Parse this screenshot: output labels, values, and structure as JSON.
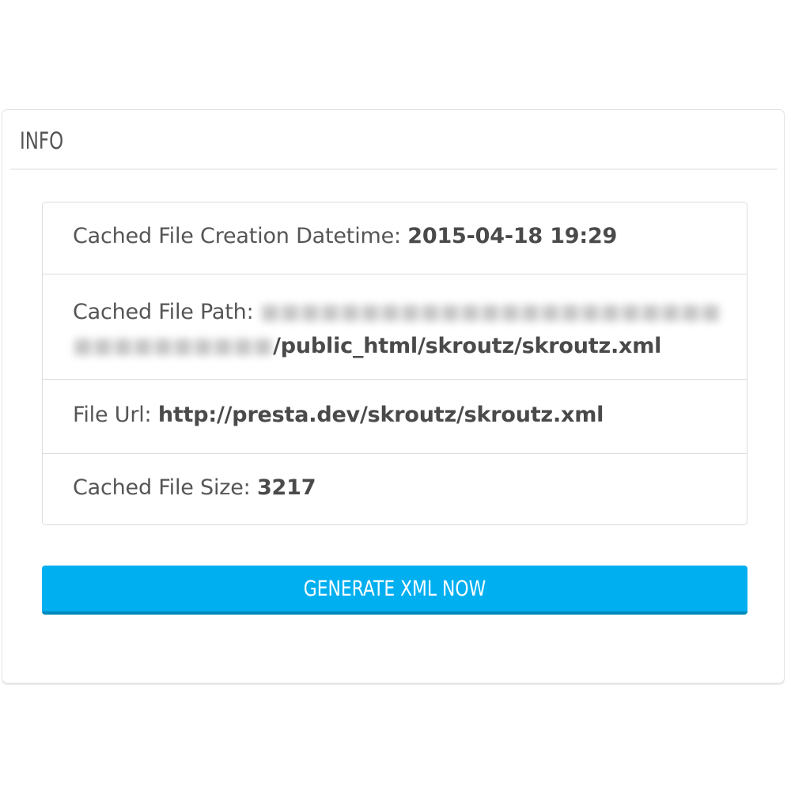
{
  "panel": {
    "title": "INFO"
  },
  "info": {
    "datetime_label": "Cached File Creation Datetime:",
    "datetime_value": "2015-04-18 19:29",
    "path_label": "Cached File Path:",
    "path_value_visible": "/public_html/skroutz/skroutz.xml",
    "url_label": "File Url:",
    "url_value": "http://presta.dev/skroutz/skroutz.xml",
    "size_label": "Cached File Size:",
    "size_value": "3217"
  },
  "actions": {
    "generate_label": "GENERATE XML NOW"
  },
  "colors": {
    "button_bg": "#00aff0",
    "text": "#555555"
  }
}
